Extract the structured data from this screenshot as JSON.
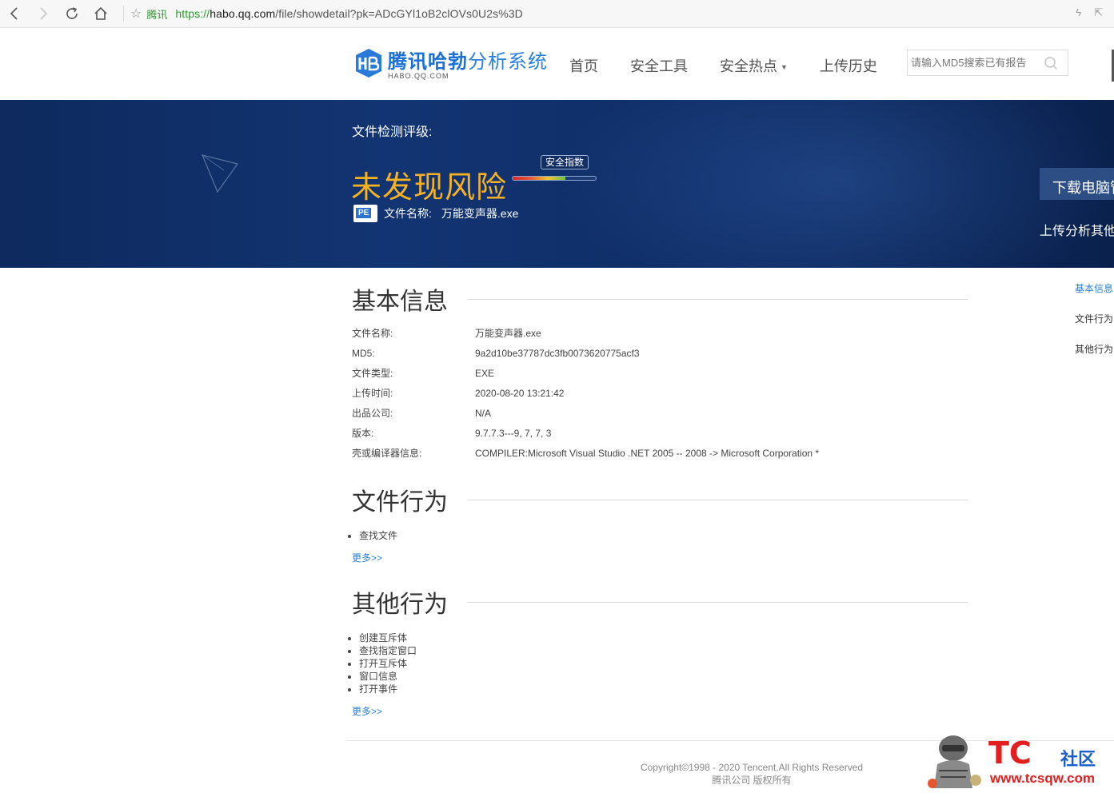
{
  "browser": {
    "site_tag": "腾讯",
    "url_proto": "https://",
    "url_host": "habo.qq.com",
    "url_path": "/file/showdetail?pk=ADcGYl1oB2clOVs0U2s%3D"
  },
  "header": {
    "logo_main": "腾讯哈勃",
    "logo_main_thin": "分析系统",
    "logo_sub": "HABO.QQ.COM",
    "nav": [
      "首页",
      "安全工具",
      "安全热点",
      "上传历史"
    ],
    "search_placeholder": "请输入MD5搜索已有报告"
  },
  "banner": {
    "title": "文件检测评级:",
    "verdict": "未发现风险",
    "score_label": "安全指数",
    "score_fraction": 0.63,
    "file_name_label": "文件名称:",
    "file_name": "万能变声器.exe",
    "download_button": "下载电脑管",
    "upload_link": "上传分析其他"
  },
  "basic_info": {
    "title": "基本信息",
    "rows": [
      {
        "k": "文件名称:",
        "v": "万能变声器.exe"
      },
      {
        "k": "MD5:",
        "v": "9a2d10be37787dc3fb0073620775acf3"
      },
      {
        "k": "文件类型:",
        "v": "EXE"
      },
      {
        "k": "上传时间:",
        "v": "2020-08-20 13:21:42"
      },
      {
        "k": "出品公司:",
        "v": "N/A"
      },
      {
        "k": "版本:",
        "v": "9.7.7.3---9, 7, 7, 3"
      },
      {
        "k": "壳或编译器信息:",
        "v": "COMPILER:Microsoft Visual Studio .NET 2005 -- 2008 -> Microsoft Corporation *"
      }
    ]
  },
  "file_behavior": {
    "title": "文件行为",
    "items": [
      "查找文件"
    ],
    "more": "更多>>"
  },
  "other_behavior": {
    "title": "其他行为",
    "items": [
      "创建互斥体",
      "查找指定窗口",
      "打开互斥体",
      "窗口信息",
      "打开事件"
    ],
    "more": "更多>>"
  },
  "side_nav": [
    "基本信息",
    "文件行为",
    "其他行为"
  ],
  "footer": {
    "copyright": "Copyright©1998 - 2020 Tencent.All Rights Reserved",
    "rights": "腾讯公司 版权所有"
  },
  "watermark": {
    "tc": "TC",
    "cn": "社区",
    "url": "www.tcsqw.com"
  },
  "colors": {
    "brand_blue": "#1b6fd8",
    "verdict_orange": "#f6b221",
    "link_blue": "#2b7fd0",
    "banner_bg": "#123472"
  }
}
